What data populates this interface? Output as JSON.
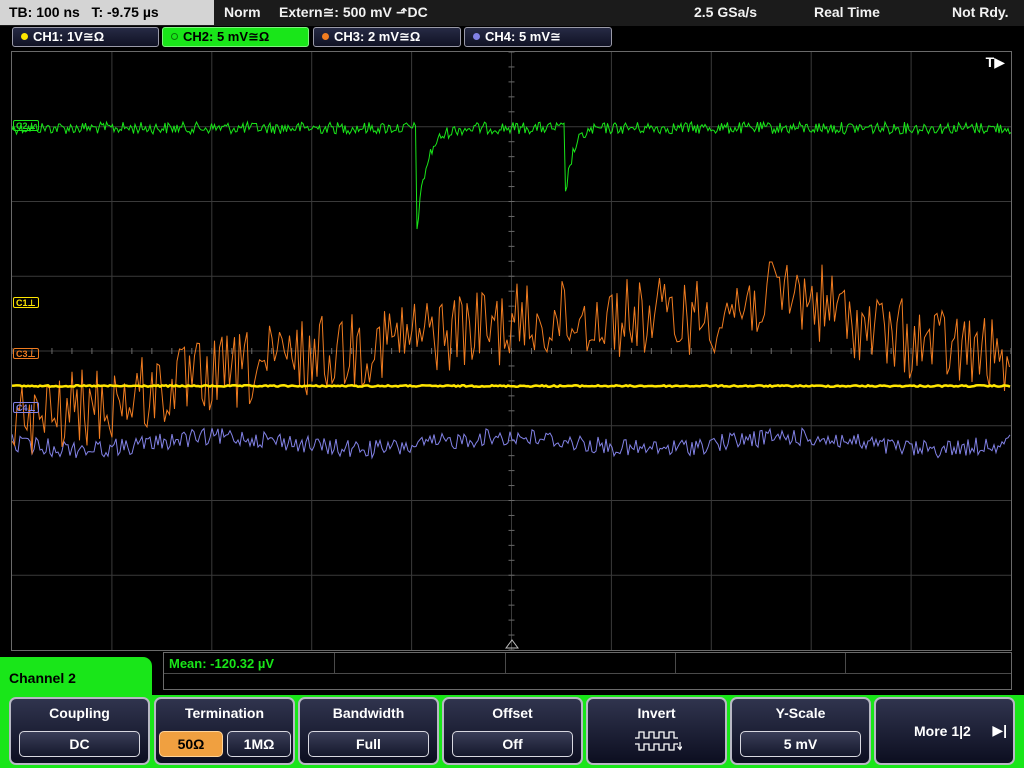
{
  "status_bar": {
    "timebase": "TB: 100 ns   T: -9.75 µs",
    "mode": "Norm",
    "trigger": "Extern≅: 500 mV ⬏DC",
    "sample_rate": "2.5 GSa/s",
    "acquisition": "Real Time",
    "state": "Not Rdy."
  },
  "channels": [
    {
      "label": "CH1: 1V≅Ω",
      "color": "#ffe600"
    },
    {
      "label": "CH2: 5 mV≅Ω",
      "color": "#19e619"
    },
    {
      "label": "CH3: 2 mV≅Ω",
      "color": "#f07c20"
    },
    {
      "label": "CH4: 5 mV≅",
      "color": "#8282e6"
    }
  ],
  "screen": {
    "trigger_indicator": "T▶",
    "markers": {
      "c1": "C1⊥",
      "c2": "C2⊥",
      "c3": "C3⊥",
      "c4": "C4⊥"
    }
  },
  "measurement": {
    "label": "Mean: -120.32 µV"
  },
  "menu_title": "Channel 2",
  "softkeys": {
    "coupling": {
      "title": "Coupling",
      "value": "DC"
    },
    "termination": {
      "title": "Termination",
      "options": [
        "50Ω",
        "1MΩ"
      ],
      "selected": "50Ω"
    },
    "bandwidth": {
      "title": "Bandwidth",
      "value": "Full"
    },
    "offset": {
      "title": "Offset",
      "value": "Off"
    },
    "invert": {
      "title": "Invert",
      "icon": "inverted-square-wave-icon"
    },
    "y_scale": {
      "title": "Y-Scale",
      "value": "5 mV"
    },
    "more": {
      "label": "More 1|2",
      "icon": "right-arrow-icon"
    }
  },
  "colors": {
    "ch1": "#ffe600",
    "ch2": "#19e619",
    "ch3": "#f07c20",
    "ch4": "#8282e6",
    "active_menu": "#19e619",
    "selected_option": "#f0a040"
  }
}
